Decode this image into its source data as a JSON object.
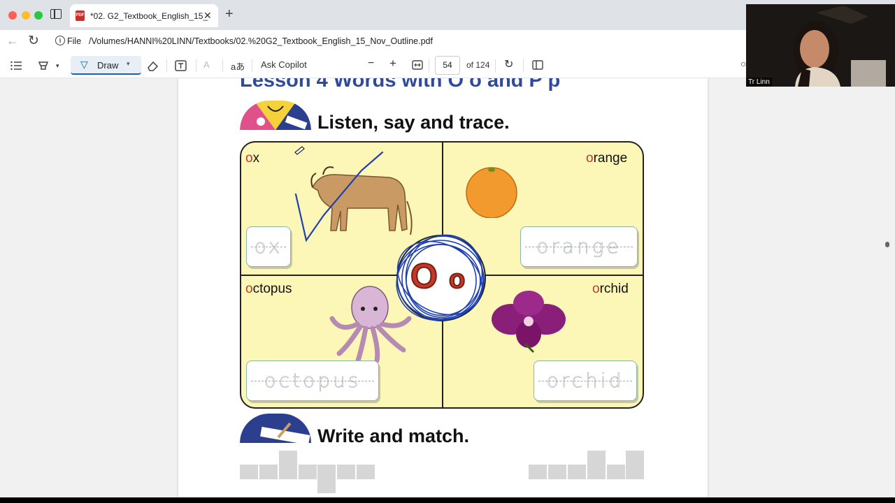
{
  "tab": {
    "title": "*02. G2_Textbook_English_15_",
    "icon": "PDF"
  },
  "address": {
    "scheme_label": "File",
    "path": "/Volumes/HANNI%20LINN/Textbooks/02.%20G2_Textbook_English_15_Nov_Outline.pdf"
  },
  "toolbar": {
    "draw_label": "Draw",
    "copilot_label": "Ask Copilot",
    "page_value": "54",
    "page_total": "of 124",
    "zoom_out": "−",
    "zoom_in": "+",
    "read_aloud": "aあ"
  },
  "pdf": {
    "lesson_title": "Lesson 4  Words with O o and P p",
    "section1_title": "Listen, say and trace.",
    "section2_title": "Write and match.",
    "letter_upper": "O",
    "letter_lower": "o",
    "words": [
      {
        "first": "o",
        "rest": "x",
        "trace": "ox"
      },
      {
        "first": "o",
        "rest": "range",
        "trace": "orange"
      },
      {
        "first": "o",
        "rest": "ctopus",
        "trace": "octopus"
      },
      {
        "first": "o",
        "rest": "rchid",
        "trace": "orchid"
      }
    ]
  },
  "webcam": {
    "name": "Tr Linn"
  },
  "colors": {
    "lesson_blue": "#2f4a9a",
    "letter_red": "#c0392b",
    "panel_yellow": "#fdf7b7",
    "annotation_blue": "#1e40b0"
  }
}
